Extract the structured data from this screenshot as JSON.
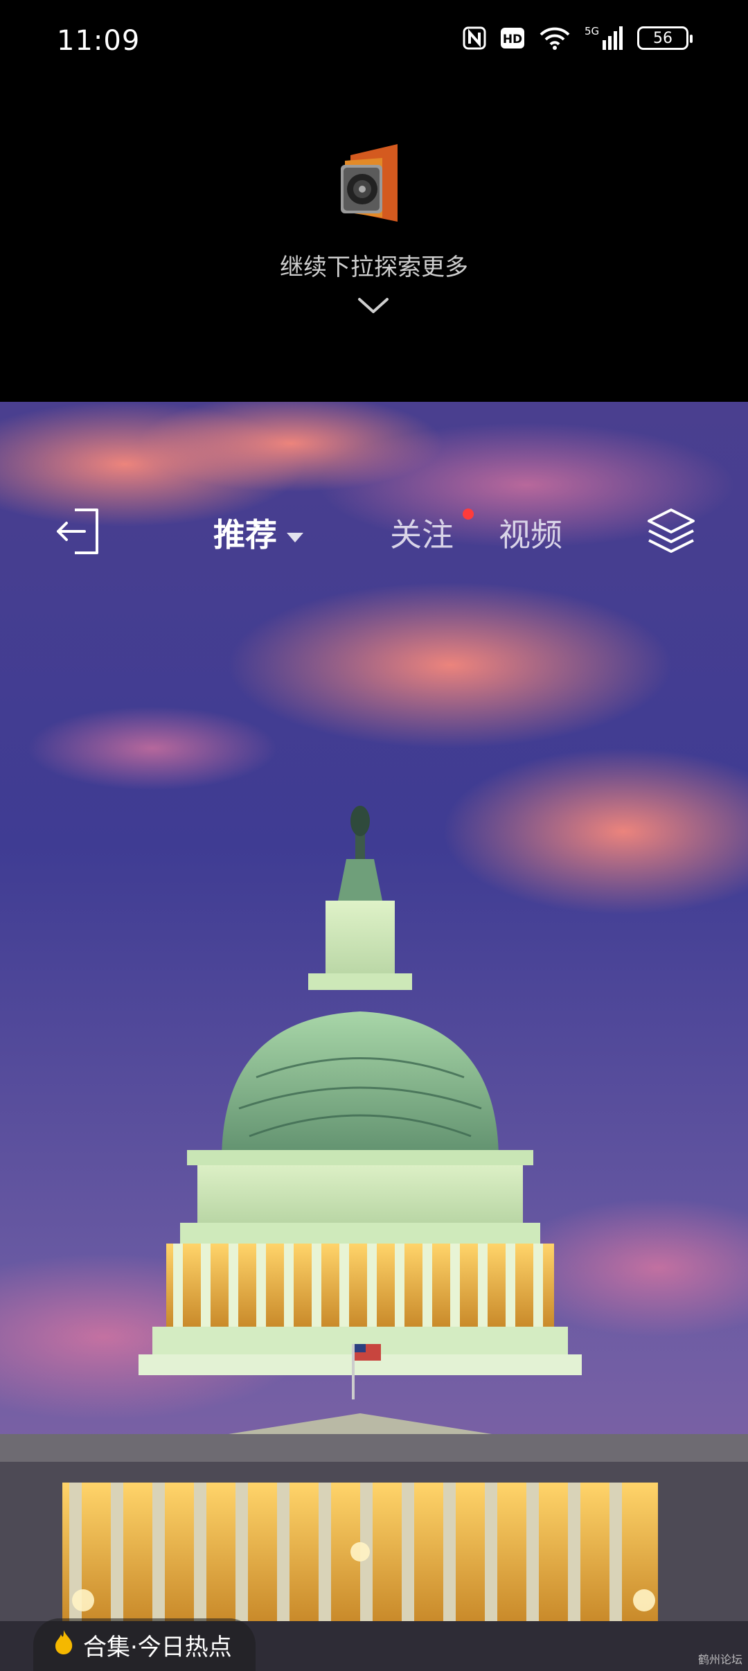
{
  "status_bar": {
    "time": "11:09",
    "battery": "56",
    "network": "5G",
    "icons": [
      "nfc-icon",
      "hd-icon",
      "wifi-icon",
      "signal-icon",
      "battery-icon"
    ]
  },
  "pull_down": {
    "hint": "继续下拉探索更多"
  },
  "nav": {
    "tabs": [
      {
        "label": "推荐",
        "active": true
      },
      {
        "label": "关注",
        "active": false,
        "has_dot": true
      },
      {
        "label": "视频",
        "active": false
      }
    ]
  },
  "bottom_chip": {
    "label": "合集·今日热点"
  },
  "watermark": "鹤州论坛",
  "colors": {
    "notification_dot": "#ff3b3b",
    "chip_flame": "#f5b800"
  }
}
